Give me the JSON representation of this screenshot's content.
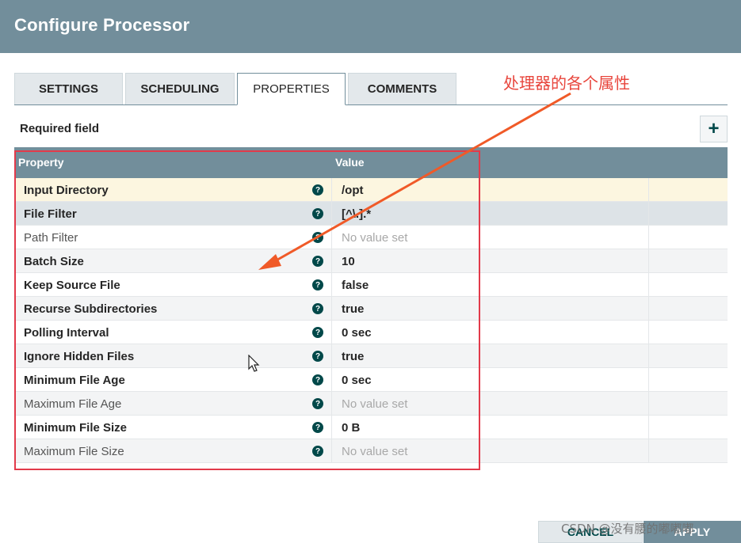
{
  "window": {
    "title": "Configure Processor"
  },
  "tabs": [
    {
      "label": "SETTINGS"
    },
    {
      "label": "SCHEDULING"
    },
    {
      "label": "PROPERTIES"
    },
    {
      "label": "COMMENTS"
    }
  ],
  "active_tab": "PROPERTIES",
  "annotation": "处理器的各个属性",
  "required_label": "Required field",
  "add_button_label": "+",
  "table": {
    "columns": [
      "Property",
      "Value"
    ],
    "rows": [
      {
        "name": "Input Directory",
        "value": "/opt",
        "required": true,
        "empty": false
      },
      {
        "name": "File Filter",
        "value": "[^\\.].*",
        "required": true,
        "empty": false
      },
      {
        "name": "Path Filter",
        "value": "No value set",
        "required": false,
        "empty": true
      },
      {
        "name": "Batch Size",
        "value": "10",
        "required": true,
        "empty": false
      },
      {
        "name": "Keep Source File",
        "value": "false",
        "required": true,
        "empty": false
      },
      {
        "name": "Recurse Subdirectories",
        "value": "true",
        "required": true,
        "empty": false
      },
      {
        "name": "Polling Interval",
        "value": "0 sec",
        "required": true,
        "empty": false
      },
      {
        "name": "Ignore Hidden Files",
        "value": "true",
        "required": true,
        "empty": false
      },
      {
        "name": "Minimum File Age",
        "value": "0 sec",
        "required": true,
        "empty": false
      },
      {
        "name": "Maximum File Age",
        "value": "No value set",
        "required": false,
        "empty": true
      },
      {
        "name": "Minimum File Size",
        "value": "0 B",
        "required": true,
        "empty": false
      },
      {
        "name": "Maximum File Size",
        "value": "No value set",
        "required": false,
        "empty": true
      }
    ]
  },
  "help_icon_glyph": "?",
  "footer": {
    "cancel": "CANCEL",
    "apply": "APPLY"
  },
  "watermark": "CSDN @没有腰的嘟嘟嘟",
  "colors": {
    "header": "#728e9b",
    "accent": "#004849",
    "annotation": "#e8453c",
    "highlight_box": "#e23a4a"
  }
}
